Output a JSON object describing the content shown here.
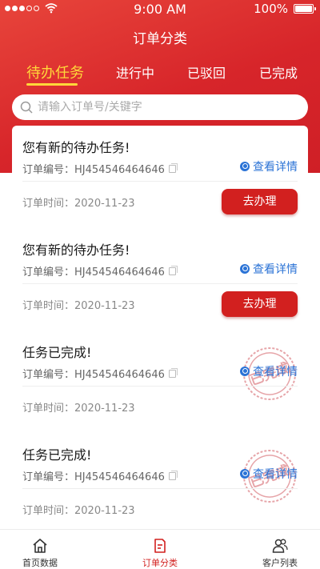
{
  "status_bar": {
    "time": "9:00 AM",
    "battery": "100%"
  },
  "nav": {
    "title": "订单分类"
  },
  "tabs": [
    {
      "label": "待办任务",
      "active": true
    },
    {
      "label": "进行中",
      "active": false
    },
    {
      "label": "已驳回",
      "active": false
    },
    {
      "label": "已完成",
      "active": false
    }
  ],
  "search": {
    "placeholder": "请输入订单号/关键字",
    "value": ""
  },
  "orders": [
    {
      "title": "您有新的待办任务!",
      "order_no": "订单编号：HJ454546464646",
      "detail_label": "查看详情",
      "time": "订单时间：2020-11-23",
      "action_label": "去办理"
    },
    {
      "title": "您有新的待办任务!",
      "order_no": "订单编号：HJ454546464646",
      "detail_label": "查看详情",
      "time": "订单时间：2020-11-23",
      "action_label": "去办理"
    },
    {
      "title": "任务已完成!",
      "order_no": "订单编号：HJ454546464646",
      "detail_label": "查看详情",
      "time": "订单时间：2020-11-23",
      "stamp": "已完成"
    },
    {
      "title": "任务已完成!",
      "order_no": "订单编号：HJ454546464646",
      "detail_label": "查看详情",
      "time": "订单时间：2020-11-23",
      "stamp": "已完成"
    }
  ],
  "bottom_nav": [
    {
      "label": "首页数据",
      "icon": "home-icon",
      "active": false
    },
    {
      "label": "订单分类",
      "icon": "order-icon",
      "active": true
    },
    {
      "label": "客户列表",
      "icon": "users-icon",
      "active": false
    }
  ],
  "colors": {
    "brand_red": "#d2201f",
    "tab_active": "#ffd83a",
    "link_blue": "#2b73d6",
    "stamp_red": "#c9373f"
  }
}
